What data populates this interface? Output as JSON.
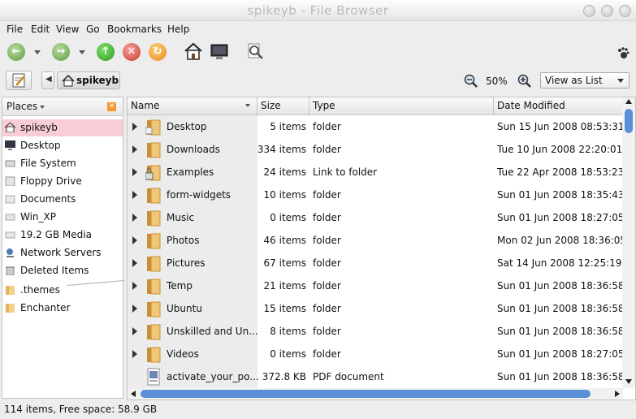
{
  "window": {
    "title": "spikeyb - File Browser"
  },
  "menu": [
    "File",
    "Edit",
    "View",
    "Go",
    "Bookmarks",
    "Help"
  ],
  "location": {
    "current": "spikeyb",
    "zoom": "50%",
    "view_mode": "View as List"
  },
  "sidebar": {
    "header": "Places",
    "items": [
      {
        "label": "spikeyb",
        "icon": "home-icon"
      },
      {
        "label": "Desktop",
        "icon": "desktop-icon"
      },
      {
        "label": "File System",
        "icon": "drive-icon"
      },
      {
        "label": "Floppy Drive",
        "icon": "floppy-icon"
      },
      {
        "label": "Documents",
        "icon": "folder-icon"
      },
      {
        "label": "Win_XP",
        "icon": "drive-icon"
      },
      {
        "label": "19.2 GB Media",
        "icon": "drive-icon"
      },
      {
        "label": "Network Servers",
        "icon": "network-icon"
      },
      {
        "label": "Deleted Items",
        "icon": "trash-icon"
      },
      {
        "label": ".themes",
        "icon": "folder-icon"
      },
      {
        "label": "Enchanter",
        "icon": "folder-icon"
      }
    ]
  },
  "columns": {
    "name": "Name",
    "size": "Size",
    "type": "Type",
    "date": "Date Modified"
  },
  "files": [
    {
      "name": "Desktop",
      "size": "5 items",
      "type": "folder",
      "date": "Sun 15 Jun 2008 08:53:31"
    },
    {
      "name": "Downloads",
      "size": "334 items",
      "type": "folder",
      "date": "Tue 10 Jun 2008 22:20:01 I"
    },
    {
      "name": "Examples",
      "size": "24 items",
      "type": "Link to folder",
      "date": "Tue 22 Apr 2008 18:53:23"
    },
    {
      "name": "form-widgets",
      "size": "10 items",
      "type": "folder",
      "date": "Sun 01 Jun 2008 18:35:43"
    },
    {
      "name": "Music",
      "size": "0 items",
      "type": "folder",
      "date": "Sun 01 Jun 2008 18:27:05"
    },
    {
      "name": "Photos",
      "size": "46 items",
      "type": "folder",
      "date": "Mon 02 Jun 2008 18:36:05"
    },
    {
      "name": "Pictures",
      "size": "67 items",
      "type": "folder",
      "date": "Sat 14 Jun 2008 12:25:19 I"
    },
    {
      "name": "Temp",
      "size": "21 items",
      "type": "folder",
      "date": "Sun 01 Jun 2008 18:36:58"
    },
    {
      "name": "Ubuntu",
      "size": "15 items",
      "type": "folder",
      "date": "Sun 01 Jun 2008 18:36:58"
    },
    {
      "name": "Unskilled and Un...",
      "size": "8 items",
      "type": "folder",
      "date": "Sun 01 Jun 2008 18:36:58"
    },
    {
      "name": "Videos",
      "size": "0 items",
      "type": "folder",
      "date": "Sun 01 Jun 2008 18:27:05"
    },
    {
      "name": "activate_your_po...",
      "size": "372.8 KB",
      "type": "PDF document",
      "date": "Sun 01 Jun 2008 18:36:58"
    }
  ],
  "status": "114 items, Free space: 58.9 GB",
  "colors": {
    "selection": "#f8cdd5",
    "folder": "#e6b25a",
    "scroll_thumb": "#5b8fd8"
  }
}
